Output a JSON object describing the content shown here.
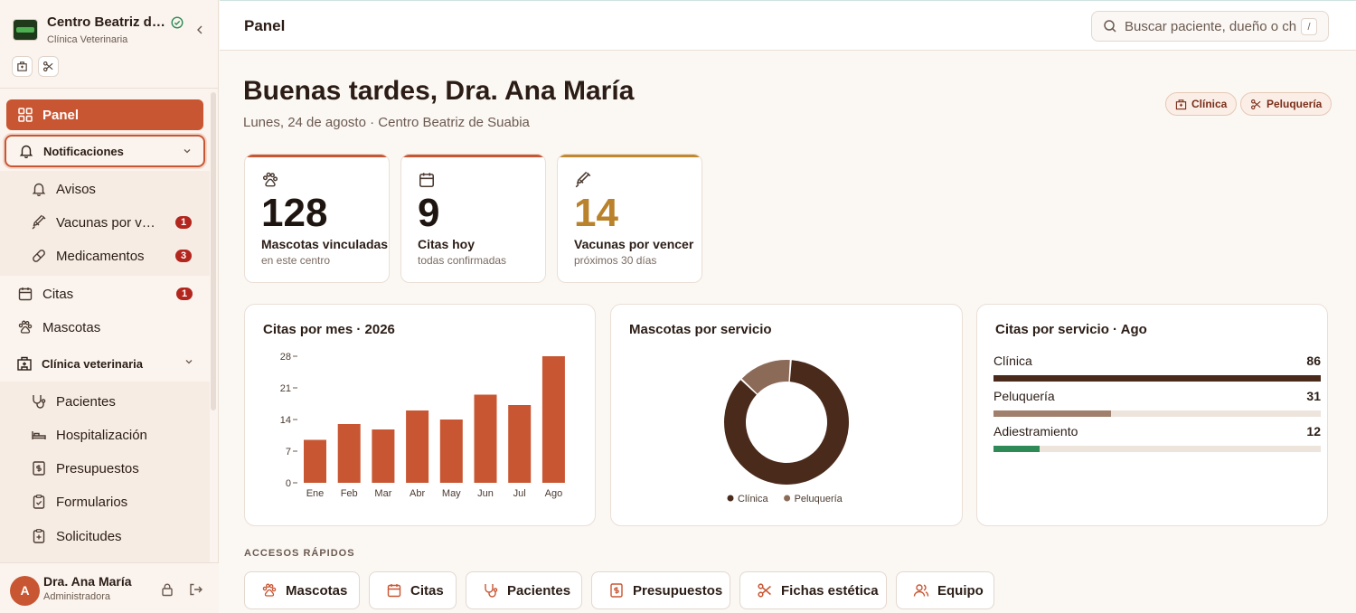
{
  "sidebar": {
    "brand_name": "Centro Beatriz de Suabia",
    "brand_subtitle": "Clínica Veterinaria",
    "nav": {
      "panel": "Panel",
      "notificaciones": "Notificaciones",
      "avisos": "Avisos",
      "vacunas": "Vacunas por vencer",
      "vacunas_badge": "1",
      "medicamentos": "Medicamentos",
      "medicamentos_badge": "3",
      "citas": "Citas",
      "citas_badge": "1",
      "mascotas": "Mascotas",
      "clinica": "Clínica veterinaria",
      "pacientes": "Pacientes",
      "hospitalizacion": "Hospitalización",
      "presupuestos": "Presupuestos",
      "formularios": "Formularios",
      "solicitudes": "Solicitudes"
    },
    "user": {
      "initial": "A",
      "name": "Dra. Ana María",
      "role": "Administradora"
    }
  },
  "topbar": {
    "title": "Panel",
    "search_placeholder": "Buscar paciente, dueño o chip…",
    "search_shortcut": "/"
  },
  "header": {
    "greeting": "Buenas tardes, Dra. Ana María",
    "subline": "Lunes, 24 de agosto · Centro Beatriz de Suabia",
    "pills": [
      "Clínica",
      "Peluquería"
    ]
  },
  "stats": [
    {
      "value": "128",
      "label": "Mascotas vinculadas",
      "sub": "en este centro"
    },
    {
      "value": "9",
      "label": "Citas hoy",
      "sub": "todas confirmadas"
    },
    {
      "value": "14",
      "label": "Vacunas por vencer",
      "sub": "próximos 30 días"
    }
  ],
  "cards": {
    "monthly_title": "Citas por mes · 2026",
    "donut_title": "Mascotas por servicio",
    "service_title": "Citas por servicio · Ago"
  },
  "chart_data": [
    {
      "type": "bar",
      "title": "Citas por mes · 2026",
      "categories": [
        "Ene",
        "Feb",
        "Mar",
        "Abr",
        "May",
        "Jun",
        "Jul",
        "Ago"
      ],
      "values": [
        9.5,
        13,
        11.8,
        16,
        14,
        19.5,
        17.2,
        28
      ],
      "ylim": [
        0,
        28
      ],
      "yticks": [
        0,
        7,
        14,
        21,
        28
      ],
      "color": "#c85632"
    },
    {
      "type": "pie",
      "title": "Mascotas por servicio",
      "series": [
        {
          "name": "Clínica",
          "value": 86,
          "color": "#4a2a1a"
        },
        {
          "name": "Peluquería",
          "value": 14,
          "color": "#8c6a58"
        }
      ]
    },
    {
      "type": "bar",
      "title": "Citas por servicio · Ago",
      "orientation": "horizontal",
      "categories": [
        "Clínica",
        "Peluquería",
        "Adiestramiento"
      ],
      "values": [
        86,
        31,
        12
      ],
      "max": 86,
      "colors": [
        "#4a2a1a",
        "#a07f6c",
        "#2e8b57"
      ]
    }
  ],
  "quick_access": {
    "title": "ACCESOS RÁPIDOS",
    "items": [
      "Mascotas",
      "Citas",
      "Pacientes",
      "Presupuestos",
      "Fichas estética",
      "Equipo"
    ]
  }
}
